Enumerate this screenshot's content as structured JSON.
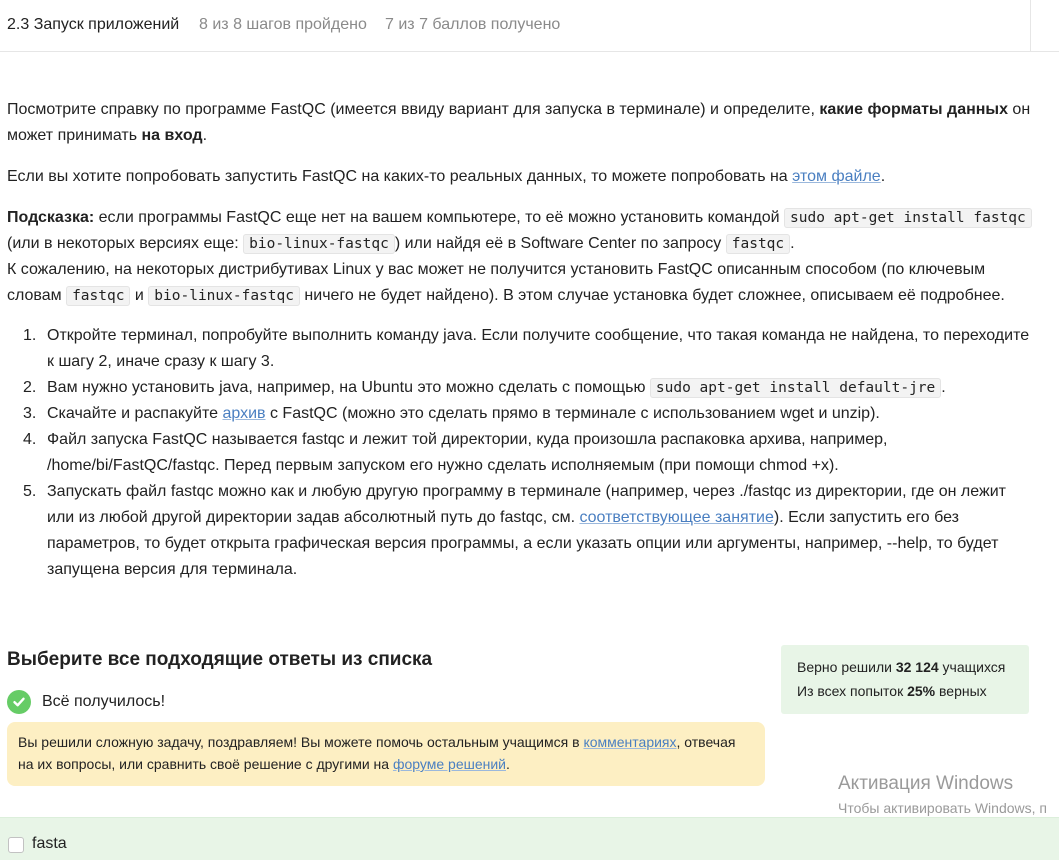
{
  "header": {
    "lesson": "2.3 Запуск приложений",
    "steps": "8 из 8 шагов пройдено",
    "score": "7 из 7 баллов  получено"
  },
  "content": {
    "p1_a": "Посмотрите справку по программе FastQC (имеется ввиду вариант для запуска в терминале) и определите, ",
    "p1_b": "какие форматы данных",
    "p1_c": " он может принимать ",
    "p1_d": "на вход",
    "p1_e": ".",
    "p2_a": "Если вы хотите попробовать запустить FastQC на каких-то реальных данных, то можете попробовать на ",
    "p2_link": "этом файле",
    "p2_b": ".",
    "hint_label": "Подсказка:",
    "hint_a": " если программы FastQC еще нет на вашем компьютере, то её можно установить командой ",
    "hint_code1": "sudo apt-get install fastqc",
    "hint_b": " (или в некоторых версиях еще: ",
    "hint_code2": "bio-linux-fastqc",
    "hint_c": ") или найдя её в Software Center по запросу ",
    "hint_code3": "fastqc",
    "hint_d": ".",
    "hint_e": "К сожалению, на некоторых дистрибутивах Linux у вас может не получится установить FastQC описанным способом (по ключевым словам ",
    "hint_code4": "fastqc",
    "hint_f": " и ",
    "hint_code5": "bio-linux-fastqc",
    "hint_g": " ничего не будет найдено). В этом случае установка будет сложнее, описываем её подробнее."
  },
  "steps": {
    "s1": "Откройте терминал, попробуйте выполнить команду java. Если получите сообщение, что такая команда не найдена, то переходите к шагу 2, иначе сразу к шагу 3.",
    "s2_a": "Вам нужно установить java, например, на Ubuntu это можно сделать с помощью ",
    "s2_code": "sudo apt-get install default-jre",
    "s2_b": ".",
    "s3_a": "Скачайте и распакуйте ",
    "s3_link": "архив",
    "s3_b": " с FastQC (можно это сделать прямо в терминале с использованием wget и unzip).",
    "s4": "Файл запуска FastQC называется fastqc и лежит той директории, куда произошла распаковка архива, например, /home/bi/FastQC/fastqc. Перед первым запуском его нужно сделать исполняемым (при помощи chmod +x).",
    "s5_a": "Запускать файл fastqc можно как и любую другую программу в терминале (например, через ./fastqc из директории, где он лежит или из любой другой директории задав абсолютный путь до fastqc, см. ",
    "s5_link": "соответствующее занятие",
    "s5_b": "). Если запустить его без параметров, то будет открыта графическая версия программы, а если указать опции или аргументы, например, --help, то будет запущена версия для терминала."
  },
  "quiz": {
    "title": "Выберите все подходящие ответы из списка",
    "success": "Всё получилось!",
    "notice_a": "Вы решили сложную задачу, поздравляем! Вы можете помочь остальным учащимся в ",
    "notice_link1": "комментариях",
    "notice_b": ", отвечая на их вопросы, или сравнить своё решение с другими на ",
    "notice_link2": "форуме решений",
    "notice_c": ".",
    "option1": "fasta"
  },
  "stats": {
    "line1_a": "Верно решили ",
    "line1_num": "32 124",
    "line1_b": " учащихся",
    "line2_a": "Из всех попыток ",
    "line2_num": "25%",
    "line2_b": " верных"
  },
  "watermark": {
    "title": "Активация Windows",
    "sub": "Чтобы активировать Windows, п"
  },
  "colors": {
    "link": "#4a7fc1",
    "success_green": "#66cc66",
    "notice_bg": "#fdefc3",
    "stats_bg": "#e8f5e7"
  }
}
